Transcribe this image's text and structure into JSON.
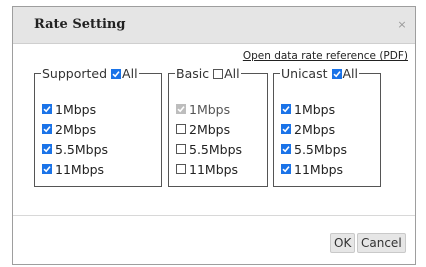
{
  "dialog": {
    "title": "Rate Setting",
    "close_glyph": "×",
    "reference_link": "Open data rate reference (PDF)"
  },
  "groups": [
    {
      "legend": "Supported",
      "all_label": "All",
      "all_checked": true,
      "rates": [
        {
          "label": "1Mbps",
          "checked": true,
          "disabled": false
        },
        {
          "label": "2Mbps",
          "checked": true,
          "disabled": false
        },
        {
          "label": "5.5Mbps",
          "checked": true,
          "disabled": false
        },
        {
          "label": "11Mbps",
          "checked": true,
          "disabled": false
        }
      ]
    },
    {
      "legend": "Basic",
      "all_label": "All",
      "all_checked": false,
      "rates": [
        {
          "label": "1Mbps",
          "checked": true,
          "disabled": true
        },
        {
          "label": "2Mbps",
          "checked": false,
          "disabled": false
        },
        {
          "label": "5.5Mbps",
          "checked": false,
          "disabled": false
        },
        {
          "label": "11Mbps",
          "checked": false,
          "disabled": false
        }
      ]
    },
    {
      "legend": "Unicast",
      "all_label": "All",
      "all_checked": true,
      "rates": [
        {
          "label": "1Mbps",
          "checked": true,
          "disabled": false
        },
        {
          "label": "2Mbps",
          "checked": true,
          "disabled": false
        },
        {
          "label": "5.5Mbps",
          "checked": true,
          "disabled": false
        },
        {
          "label": "11Mbps",
          "checked": true,
          "disabled": false
        }
      ]
    }
  ],
  "buttons": {
    "ok_label": "OK",
    "cancel_label": "Cancel"
  },
  "colors": {
    "accent": "#1a73e8",
    "titlebar": "#e5e5e5"
  }
}
